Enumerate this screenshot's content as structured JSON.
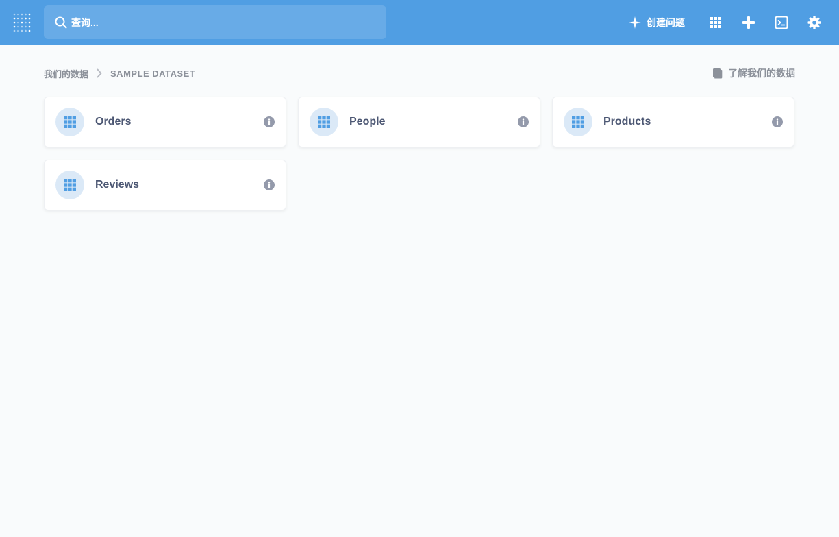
{
  "header": {
    "search_placeholder": "查询...",
    "new_question_label": "创建问题",
    "icons": {
      "logo": "metabase-logo-icon",
      "search": "search-icon",
      "new_question": "sparkle-icon",
      "browse": "grid-icon",
      "add": "plus-icon",
      "native_query": "terminal-icon",
      "settings": "gear-icon"
    },
    "color": "#509ee3"
  },
  "breadcrumb": {
    "root": "我们的数据",
    "current": "Sample Dataset"
  },
  "learn_link": {
    "label": "了解我们的数据",
    "icon": "book-icon"
  },
  "tables": [
    {
      "name": "Orders"
    },
    {
      "name": "People"
    },
    {
      "name": "Products"
    },
    {
      "name": "Reviews"
    }
  ],
  "colors": {
    "brand": "#509ee3",
    "text_dark": "#4c5773",
    "text_muted": "#8c919a",
    "icon_bg": "#dbe9f7"
  }
}
